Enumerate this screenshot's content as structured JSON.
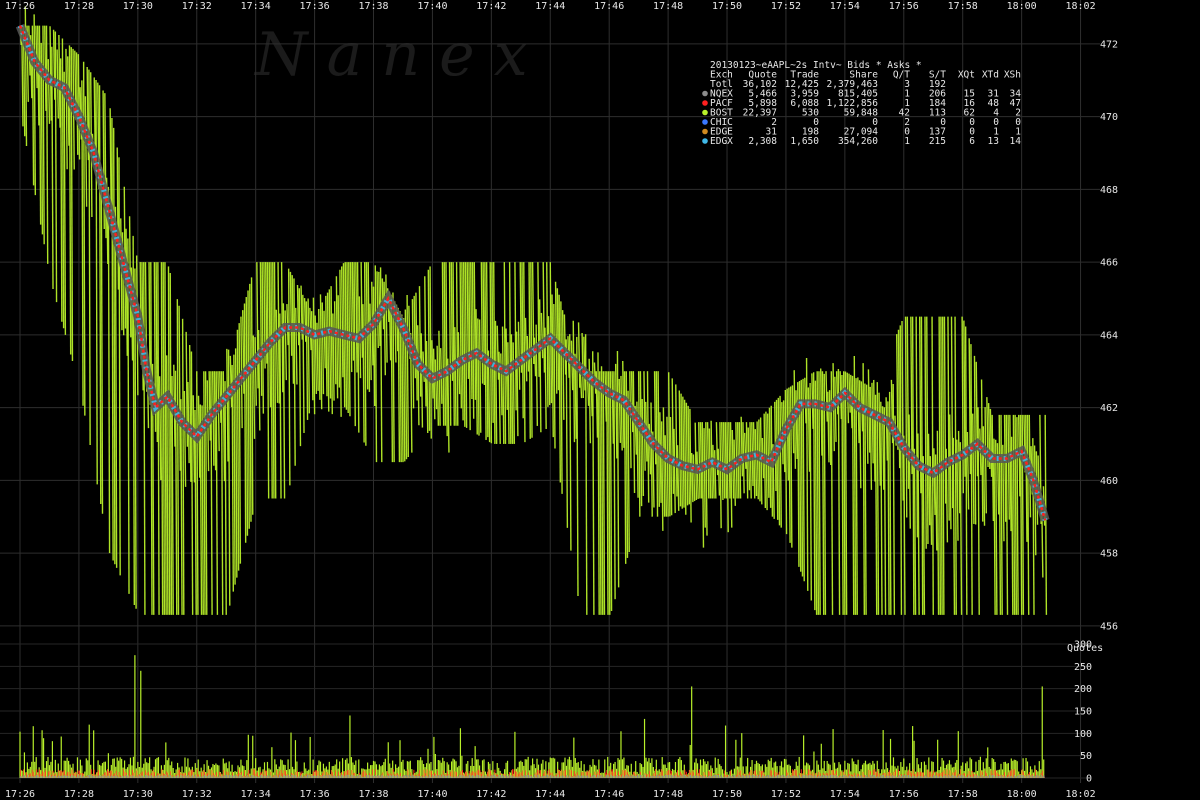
{
  "watermark": "N a n e x",
  "legend": {
    "title": "20130123~eAAPL~2s Intv~ Bids * Asks *",
    "headers": [
      "Exch",
      "Quote",
      "Trade",
      "Share",
      "Q/T",
      "S/T",
      "XQt",
      "XTd",
      "XSh"
    ],
    "rows": [
      {
        "exch": "Totl",
        "quote": "36,102",
        "trade": "12,425",
        "share": "2,379,463",
        "qt": "3",
        "st": "192",
        "xqt": "",
        "xtd": "",
        "xsh": "",
        "color": ""
      },
      {
        "exch": "NQEX",
        "quote": "5,466",
        "trade": "3,959",
        "share": "815,405",
        "qt": "1",
        "st": "206",
        "xqt": "15",
        "xtd": "31",
        "xsh": "34",
        "color": "#8c8c8c"
      },
      {
        "exch": "PACF",
        "quote": "5,898",
        "trade": "6,088",
        "share": "1,122,856",
        "qt": "1",
        "st": "184",
        "xqt": "16",
        "xtd": "48",
        "xsh": "47",
        "color": "#ff2020"
      },
      {
        "exch": "BOST",
        "quote": "22,397",
        "trade": "530",
        "share": "59,848",
        "qt": "42",
        "st": "113",
        "xqt": "62",
        "xtd": "4",
        "xsh": "2",
        "color": "#b8f02a"
      },
      {
        "exch": "CHIC",
        "quote": "2",
        "trade": "0",
        "share": "0",
        "qt": "2",
        "st": "0",
        "xqt": "0",
        "xtd": "0",
        "xsh": "0",
        "color": "#3a78ff"
      },
      {
        "exch": "EDGE",
        "quote": "31",
        "trade": "198",
        "share": "27,094",
        "qt": "0",
        "st": "137",
        "xqt": "0",
        "xtd": "1",
        "xsh": "1",
        "color": "#d08a20"
      },
      {
        "exch": "EDGX",
        "quote": "2,308",
        "trade": "1,650",
        "share": "354,260",
        "qt": "1",
        "st": "215",
        "xqt": "6",
        "xtd": "13",
        "xsh": "14",
        "color": "#40b8e8"
      }
    ]
  },
  "quotes_label": "Quotes",
  "chart_data": [
    {
      "type": "line",
      "name": "price",
      "x_ticks": [
        "17:26",
        "17:28",
        "17:30",
        "17:32",
        "17:34",
        "17:36",
        "17:38",
        "17:40",
        "17:42",
        "17:44",
        "17:46",
        "17:48",
        "17:50",
        "17:52",
        "17:54",
        "17:56",
        "17:58",
        "18:00",
        "18:02"
      ],
      "y_ticks": [
        456,
        458,
        460,
        462,
        464,
        466,
        468,
        470,
        472
      ],
      "ylim": [
        455.5,
        472.6
      ],
      "xlim_minutes": [
        0,
        37
      ],
      "grid": true,
      "series": [
        {
          "exchange": "PACF",
          "color": "#ff2020",
          "x_minutes": [
            0,
            0.5,
            1,
            1.5,
            2,
            2.5,
            3,
            3.5,
            4,
            4.3,
            4.6,
            5,
            5.5,
            6,
            6.5,
            7,
            7.5,
            8,
            8.5,
            9,
            9.5,
            10,
            10.5,
            11,
            11.5,
            12,
            12.5,
            13,
            13.5,
            14,
            14.5,
            15,
            15.5,
            16,
            16.5,
            17,
            17.5,
            18,
            18.5,
            19,
            19.5,
            20,
            20.5,
            21,
            21.5,
            22,
            22.5,
            23,
            23.5,
            24,
            24.5,
            25,
            25.5,
            26,
            26.5,
            27,
            27.5,
            28,
            28.5,
            29,
            29.5,
            30,
            30.5,
            31,
            31.5,
            32,
            32.5,
            33,
            33.5,
            34,
            34.4,
            34.8
          ],
          "values": [
            472.5,
            471.5,
            471,
            470.8,
            470,
            469,
            467.5,
            466,
            464.5,
            463,
            462,
            462.3,
            461.6,
            461.2,
            461.8,
            462.3,
            462.8,
            463.3,
            463.8,
            464.2,
            464.2,
            464,
            464.1,
            464,
            463.9,
            464.3,
            465,
            464.2,
            463.2,
            462.8,
            463,
            463.3,
            463.5,
            463.2,
            463,
            463.3,
            463.6,
            463.9,
            463.5,
            463.1,
            462.7,
            462.4,
            462.2,
            461.6,
            461,
            460.6,
            460.4,
            460.3,
            460.5,
            460.3,
            460.6,
            460.7,
            460.5,
            461.4,
            462.1,
            462.1,
            462,
            462.4,
            462,
            461.8,
            461.6,
            460.9,
            460.4,
            460.2,
            460.5,
            460.7,
            461,
            460.6,
            460.6,
            460.8,
            460,
            458.9
          ]
        }
      ],
      "bid_ask_band": {
        "exchange": "BOST",
        "color": "#b8f02a",
        "x_minutes": [
          0,
          1,
          2,
          3,
          4,
          5,
          6,
          7,
          8,
          9,
          10,
          11,
          12,
          13,
          14,
          15,
          16,
          17,
          18,
          19,
          20,
          21,
          22,
          23,
          24,
          25,
          26,
          27,
          28,
          29,
          30,
          31,
          32,
          33,
          34,
          34.8
        ],
        "ask": [
          472.5,
          472.5,
          471.7,
          470.5,
          466,
          466,
          463,
          463,
          466,
          466,
          464.5,
          466,
          466,
          464.5,
          466,
          466,
          466,
          466,
          466,
          463,
          463,
          463,
          463,
          461.6,
          461.6,
          461.6,
          462.5,
          463,
          463,
          462.5,
          464.5,
          464.5,
          464.5,
          461.8,
          461.8,
          461.8
        ],
        "bid": [
          470,
          465.5,
          462.5,
          458,
          456.3,
          456.3,
          456.3,
          456.3,
          459.5,
          459.5,
          462.5,
          462,
          460.5,
          460.5,
          461.5,
          461.5,
          461,
          461,
          461.5,
          456.3,
          456.3,
          459,
          459,
          459.5,
          459.5,
          459.5,
          458.5,
          456.3,
          456.3,
          456.3,
          456.3,
          456.3,
          456.3,
          456.3,
          456.3,
          456.3
        ]
      }
    },
    {
      "type": "bar",
      "name": "Quotes",
      "y_ticks": [
        0,
        50,
        100,
        150,
        200,
        250,
        300
      ],
      "ylim": [
        0,
        300
      ],
      "bin_seconds": 2,
      "series": [
        {
          "exchange": "BOST",
          "color": "#b8f02a",
          "peaks": [
            {
              "minute": 3.9,
              "value": 275
            },
            {
              "minute": 4.1,
              "value": 240
            },
            {
              "minute": 11.2,
              "value": 140
            },
            {
              "minute": 22.8,
              "value": 205
            },
            {
              "minute": 34.7,
              "value": 205
            }
          ],
          "typical": 25
        },
        {
          "exchange": "PACF",
          "color": "#ff2020",
          "typical": 10
        },
        {
          "exchange": "NQEX",
          "color": "#8c8c8c",
          "typical": 5
        }
      ]
    }
  ]
}
